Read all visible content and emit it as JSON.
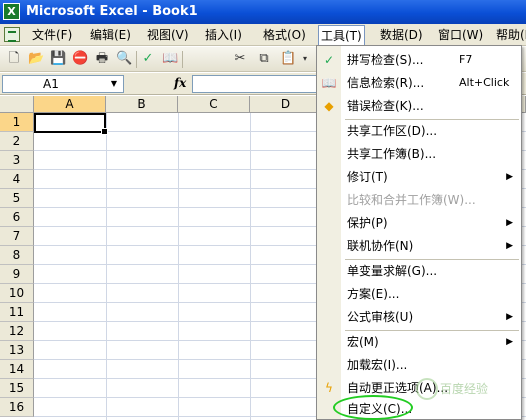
{
  "window": {
    "title": "Microsoft Excel - Book1",
    "app_icon": "X"
  },
  "menubar": {
    "items": [
      {
        "label": "文件(F)"
      },
      {
        "label": "编辑(E)"
      },
      {
        "label": "视图(V)"
      },
      {
        "label": "插入(I)"
      },
      {
        "label": "格式(O)"
      },
      {
        "label": "工具(T)"
      },
      {
        "label": "数据(D)"
      },
      {
        "label": "窗口(W)"
      },
      {
        "label": "帮助(H)"
      }
    ],
    "active": "工具(T)"
  },
  "toolbar": {
    "icons": [
      "new-icon",
      "open-icon",
      "save-icon",
      "permission-icon",
      "print-icon",
      "print-preview-icon",
      "spelling-icon",
      "research-icon",
      "cut-icon",
      "copy-icon",
      "paste-icon"
    ]
  },
  "formula_bar": {
    "name_box": "A1",
    "fx_label": "fx",
    "formula": ""
  },
  "grid": {
    "columns": [
      "A",
      "B",
      "C",
      "D"
    ],
    "rows": [
      "1",
      "2",
      "3",
      "4",
      "5",
      "6",
      "7",
      "8",
      "9",
      "10",
      "11",
      "12",
      "13",
      "14",
      "15",
      "16"
    ],
    "selected_cell": "A1"
  },
  "tools_menu": {
    "items": [
      {
        "label": "拼写检查(S)...",
        "shortcut": "F7",
        "icon": "spelling-icon"
      },
      {
        "label": "信息检索(R)...",
        "shortcut": "Alt+Click",
        "icon": "research-icon"
      },
      {
        "label": "错误检查(K)...",
        "icon": "error-check-icon"
      },
      {
        "label": "共享工作区(D)..."
      },
      {
        "label": "共享工作簿(B)..."
      },
      {
        "label": "修订(T)",
        "submenu": true
      },
      {
        "label": "比较和合并工作簿(W)...",
        "disabled": true
      },
      {
        "label": "保护(P)",
        "submenu": true
      },
      {
        "label": "联机协作(N)",
        "submenu": true
      },
      {
        "label": "单变量求解(G)..."
      },
      {
        "label": "方案(E)..."
      },
      {
        "label": "公式审核(U)",
        "submenu": true
      },
      {
        "label": "宏(M)",
        "submenu": true
      },
      {
        "label": "加载宏(I)..."
      },
      {
        "label": "自动更正选项(A)...",
        "icon": "autocorrect-icon"
      },
      {
        "label": "自定义(C)..."
      }
    ],
    "highlighted_item": "自定义(C)..."
  },
  "watermark": {
    "text": "百度经验"
  },
  "colors": {
    "titlebar": "#0a4fd6",
    "highlight": "#22cc22",
    "selected_header": "#fbd689"
  }
}
